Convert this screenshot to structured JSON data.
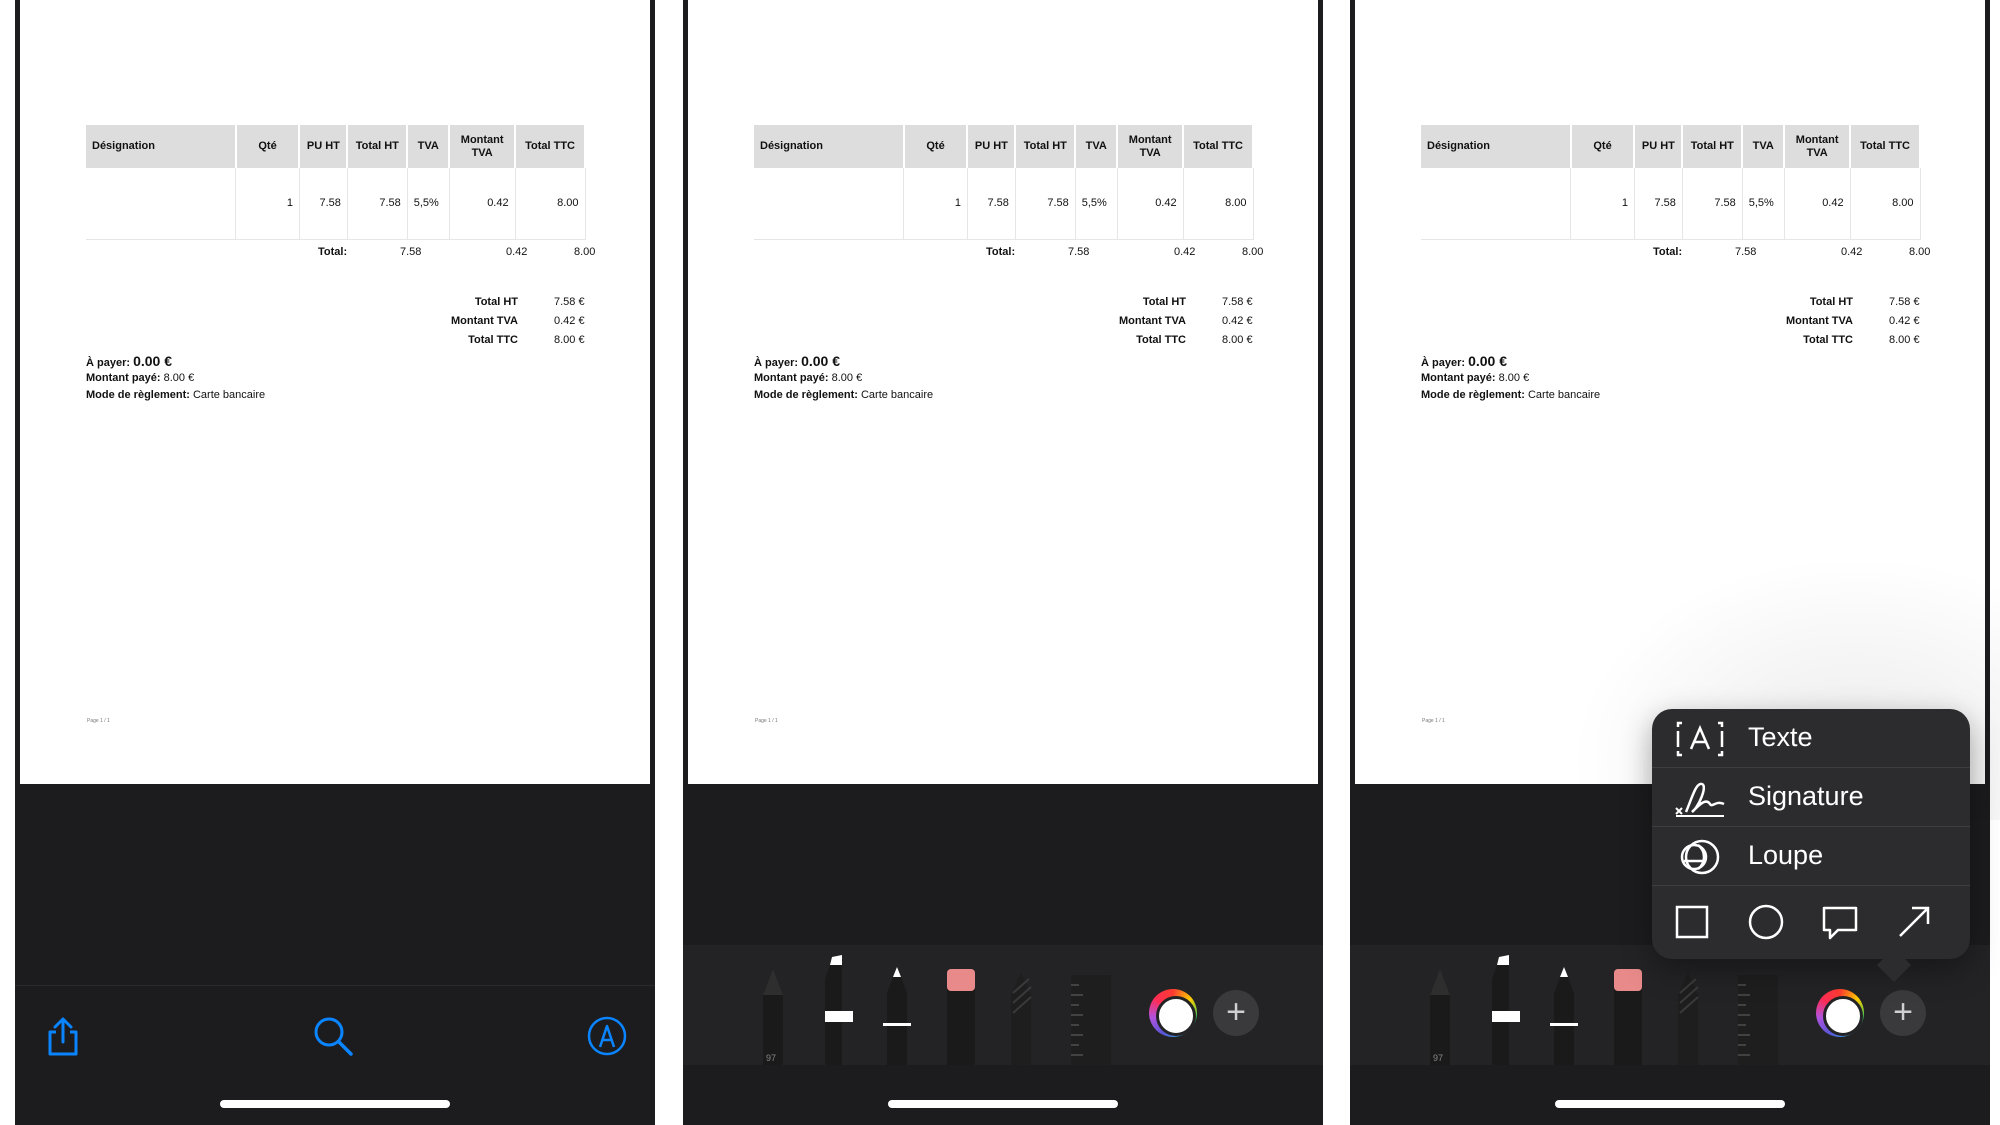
{
  "document": {
    "headers": [
      "Désignation",
      "Qté",
      "PU HT",
      "Total HT",
      "TVA",
      "Montant TVA",
      "Total TTC"
    ],
    "row": [
      "",
      "1",
      "7.58",
      "7.58",
      "5,5%",
      "0.42",
      "8.00"
    ],
    "totals_row": {
      "label": "Total:",
      "total_ht": "7.58",
      "montant_tva": "0.42",
      "total_ttc": "8.00"
    },
    "summary": [
      {
        "label": "Total HT",
        "value": "7.58 €"
      },
      {
        "label": "Montant TVA",
        "value": "0.42 €"
      },
      {
        "label": "Total TTC",
        "value": "8.00 €"
      }
    ],
    "a_payer_label": "À payer:",
    "a_payer_value": "0.00 €",
    "montant_paye_label": "Montant payé:",
    "montant_paye_value": "8.00 €",
    "mode_label": "Mode de règlement:",
    "mode_value": "Carte bancaire",
    "footer": "Page 1 / 1"
  },
  "toolbar": {
    "icons": [
      "share-icon",
      "search-icon",
      "markup-icon"
    ],
    "accent": "#0a84ff"
  },
  "markup_tools": {
    "pen_label": "97",
    "tools": [
      "pen",
      "marker",
      "pencil",
      "eraser",
      "lasso",
      "ruler"
    ]
  },
  "menu": {
    "items": [
      "Texte",
      "Signature",
      "Loupe"
    ],
    "shapes": [
      "square-icon",
      "circle-icon",
      "speech-bubble-icon",
      "arrow-icon"
    ]
  }
}
